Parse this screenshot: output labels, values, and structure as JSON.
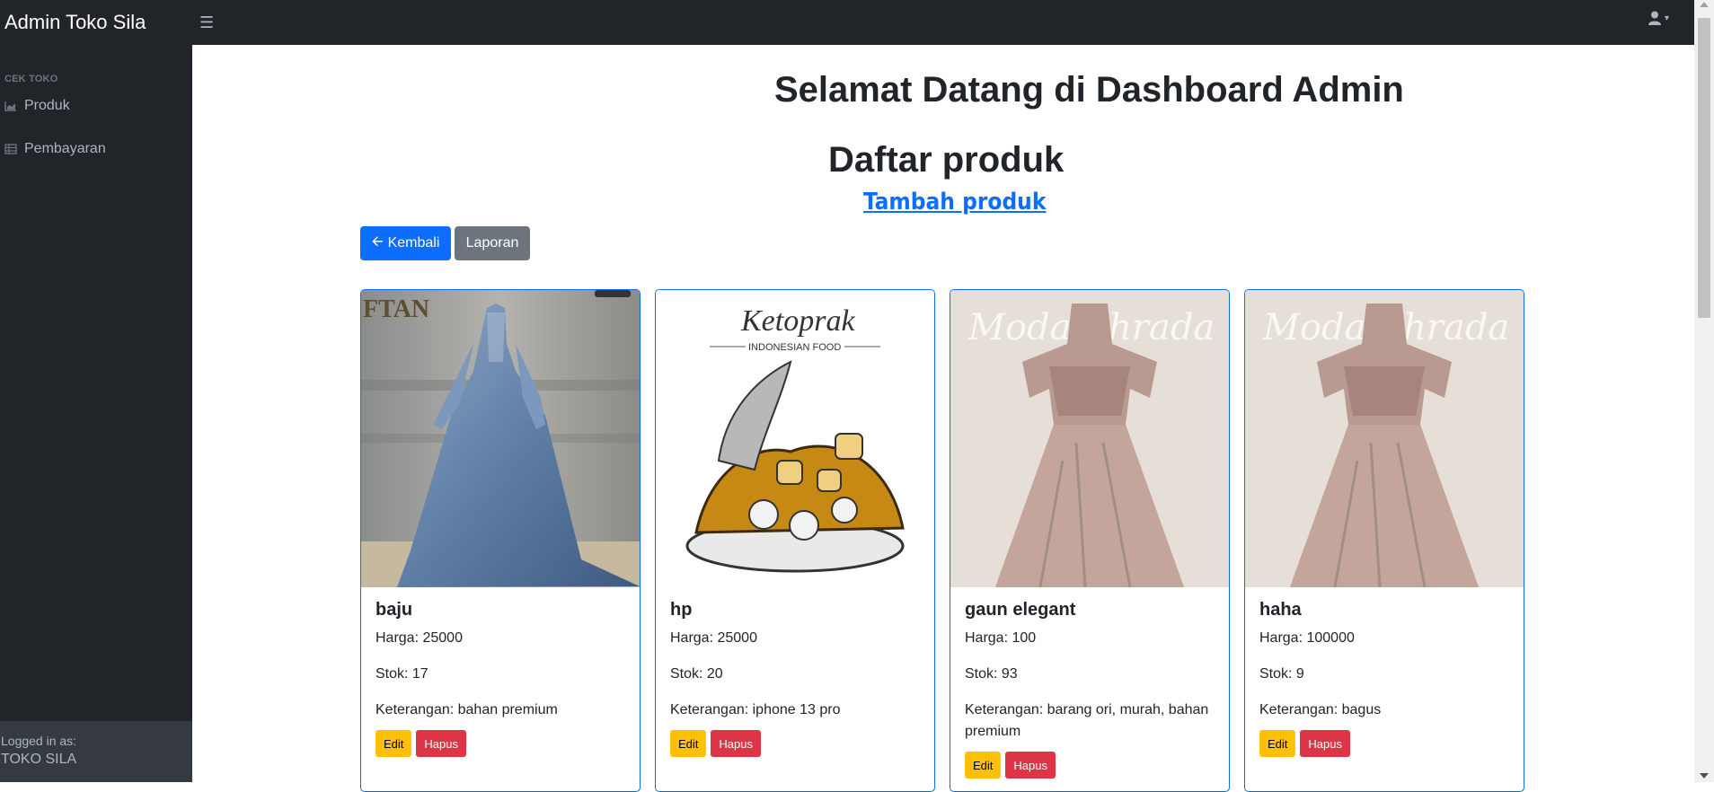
{
  "app": {
    "brand": "Admin Toko Sila"
  },
  "sidebar": {
    "heading": "CEK TOKO",
    "items": [
      {
        "label": "Produk",
        "icon": "chart-area-icon"
      },
      {
        "label": "Pembayaran",
        "icon": "table-icon"
      }
    ],
    "footer": {
      "logged_in_label": "Logged in as:",
      "user": "TOKO SILA"
    }
  },
  "main": {
    "welcome": "Selamat Datang di Dashboard Admin",
    "list_title": "Daftar produk",
    "add_link": "Tambah produk",
    "back_button": "Kembali",
    "report_button": "Laporan"
  },
  "products": [
    {
      "name": "baju",
      "harga": "Harga: 25000",
      "stok": "Stok: 17",
      "keterangan": "Keterangan: bahan premium",
      "edit": "Edit",
      "hapus": "Hapus",
      "image": "blue-gown"
    },
    {
      "name": "hp",
      "harga": "Harga: 25000",
      "stok": "Stok: 20",
      "keterangan": "Keterangan: iphone 13 pro",
      "edit": "Edit",
      "hapus": "Hapus",
      "image": "ketoprak-illustration",
      "image_title": "Ketoprak",
      "image_subtitle": "INDONESIAN FOOD"
    },
    {
      "name": "gaun elegant",
      "harga": "Harga: 100",
      "stok": "Stok: 93",
      "keterangan": "Keterangan: barang ori, murah, bahan premium",
      "edit": "Edit",
      "hapus": "Hapus",
      "image": "pink-gown",
      "image_sign": "Moda Ahrada"
    },
    {
      "name": "haha",
      "harga": "Harga: 100000",
      "stok": "Stok: 9",
      "keterangan": "Keterangan: bagus",
      "edit": "Edit",
      "hapus": "Hapus",
      "image": "pink-gown",
      "image_sign": "Moda Ahrada"
    }
  ],
  "colors": {
    "primary": "#0d6efd",
    "secondary": "#6c757d",
    "warning": "#ffc107",
    "danger": "#dc3545",
    "dark": "#212529"
  }
}
